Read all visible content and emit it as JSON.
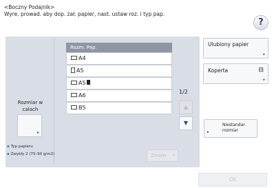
{
  "header": {
    "line1": "<Boczny Podajnik>",
    "line2": "Wyre. prowad. aby dop. zał. papier, nast. ustaw roz. i typ pap."
  },
  "help": {
    "label": "?"
  },
  "left": {
    "size_label_line1": "Rozmiar w",
    "size_label_line2": "calach",
    "arrow": "▸"
  },
  "table": {
    "header": "Rozm. Pap.",
    "rows": [
      {
        "label": "A4",
        "checked": false
      },
      {
        "label": "A5",
        "checked": false
      },
      {
        "label": "A5",
        "checked": false
      },
      {
        "label": "A6",
        "checked": false
      },
      {
        "label": "B5",
        "checked": false
      }
    ]
  },
  "pager": {
    "page": "1/2",
    "up": "▲",
    "down": "▼"
  },
  "info": {
    "line1": "Typ papieru",
    "line2": "Zwykły 2 (75–90 g/m2)"
  },
  "change_label": "Zmień",
  "right": {
    "favorite_label": "Ulubiony papier",
    "envelope_label": "Koperta",
    "envelope_icon": "⊟",
    "custom_line1": "Niestandar.",
    "custom_line2": "rozmiar"
  },
  "ok_label": "OK",
  "colors": {
    "panel": "#d8dde6",
    "table_header": "#8e96a4",
    "bullet": "#2a7fd0"
  }
}
